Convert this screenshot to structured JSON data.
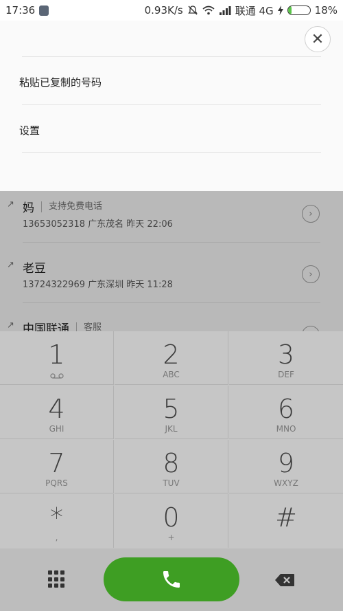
{
  "status_bar": {
    "time": "17:36",
    "speed": "0.93K/s",
    "carrier": "联通 4G",
    "battery": "18%",
    "battery_level": 0.18
  },
  "menu": {
    "items": [
      "粘贴已复制的号码",
      "设置"
    ]
  },
  "recent_calls": [
    {
      "name": "妈",
      "tag": "支持免费电话",
      "number": "13653052318",
      "location": "广东茂名",
      "time": "昨天 22:06"
    },
    {
      "name": "老豆",
      "tag": "",
      "number": "13724322969",
      "location": "广东深圳",
      "time": "昨天 11:28"
    },
    {
      "name": "中国联通",
      "tag": "客服",
      "number": "",
      "location": "",
      "time": ""
    }
  ],
  "keypad": [
    {
      "digit": "1",
      "letters": ""
    },
    {
      "digit": "2",
      "letters": "ABC"
    },
    {
      "digit": "3",
      "letters": "DEF"
    },
    {
      "digit": "4",
      "letters": "GHI"
    },
    {
      "digit": "5",
      "letters": "JKL"
    },
    {
      "digit": "6",
      "letters": "MNO"
    },
    {
      "digit": "7",
      "letters": "PQRS"
    },
    {
      "digit": "8",
      "letters": "TUV"
    },
    {
      "digit": "9",
      "letters": "WXYZ"
    },
    {
      "digit": "*",
      "letters": ","
    },
    {
      "digit": "0",
      "letters": "+"
    },
    {
      "digit": "#",
      "letters": ""
    }
  ],
  "colors": {
    "call_button": "#3e9e23",
    "battery_fill": "#5cc54b"
  }
}
